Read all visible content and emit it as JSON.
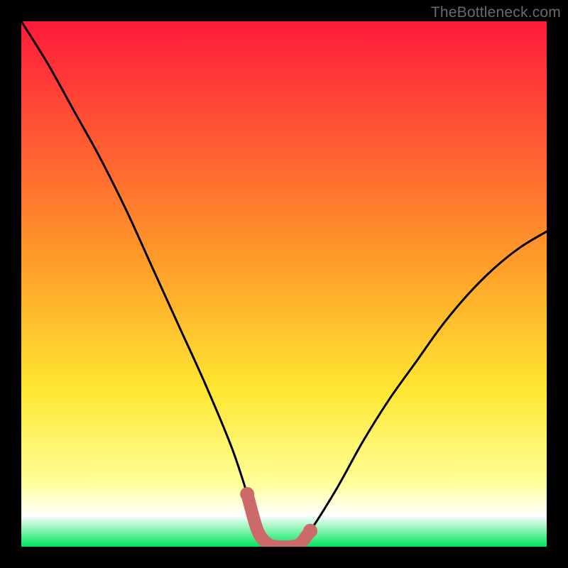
{
  "attribution": "TheBottleneck.com",
  "icons": {},
  "colors": {
    "page_bg": "#000000",
    "gradient_top": "#ff1a3a",
    "gradient_mid_upper": "#ff8a2a",
    "gradient_mid": "#ffe631",
    "gradient_low": "#ffff7a",
    "gradient_bottom": "#ffffff",
    "base_band": "#00e65a",
    "curve": "#000000",
    "highlight": "#cc6a6a",
    "attribution_text": "#6a6a6a"
  },
  "chart_data": {
    "type": "line",
    "title": "",
    "xlabel": "",
    "ylabel": "",
    "xlim": [
      0,
      100
    ],
    "ylim": [
      0,
      100
    ],
    "grid": false,
    "legend": null,
    "series": [
      {
        "name": "bottleneck-curve",
        "x": [
          0,
          5,
          10,
          15,
          20,
          25,
          30,
          35,
          40,
          43,
          45,
          47,
          49,
          51,
          53,
          55,
          60,
          65,
          70,
          75,
          80,
          85,
          90,
          95,
          100
        ],
        "values": [
          100,
          92,
          83,
          74,
          64,
          53,
          42,
          31,
          19,
          10,
          3,
          0.5,
          0,
          0,
          0.5,
          3,
          11,
          20,
          28,
          35,
          42,
          48,
          53,
          57,
          60
        ]
      }
    ],
    "highlight_region": {
      "x_start": 44,
      "x_end": 56,
      "description": "flat basin near zero bottleneck"
    },
    "background_gradient_stops": [
      {
        "pos": 0.0,
        "color": "#ff1a3a"
      },
      {
        "pos": 0.45,
        "color": "#ff9a2a"
      },
      {
        "pos": 0.7,
        "color": "#ffe631"
      },
      {
        "pos": 0.88,
        "color": "#ffff9a"
      },
      {
        "pos": 0.94,
        "color": "#ffffff"
      },
      {
        "pos": 1.0,
        "color": "#00e65a"
      }
    ]
  }
}
